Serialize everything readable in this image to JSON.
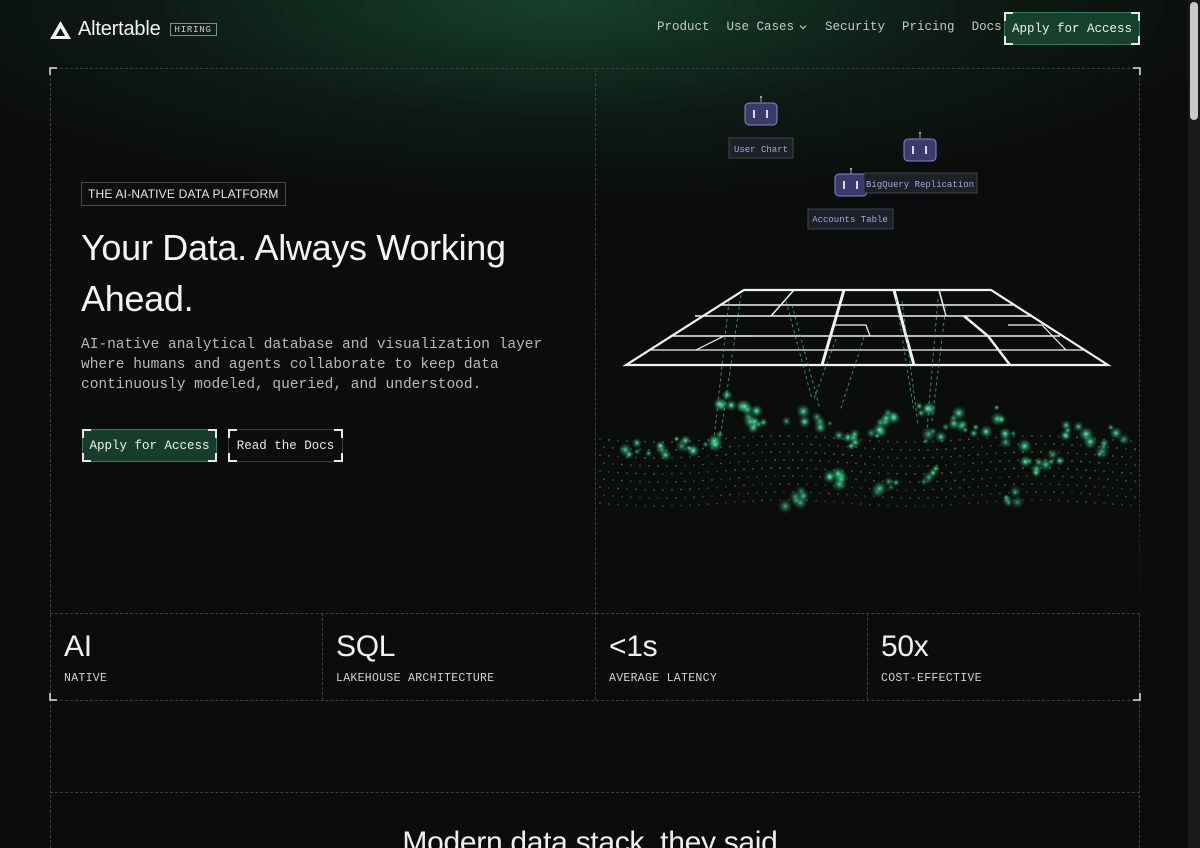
{
  "header": {
    "brand": "Altertable",
    "badge": "HIRING",
    "nav": [
      {
        "label": "Product"
      },
      {
        "label": "Use Cases",
        "has_dropdown": true
      },
      {
        "label": "Security"
      },
      {
        "label": "Pricing"
      },
      {
        "label": "Docs"
      }
    ],
    "cta_label": "Apply for Access"
  },
  "hero": {
    "eyebrow": "THE AI-NATIVE DATA PLATFORM",
    "headline": "Your Data. Always Working Ahead.",
    "subcopy": "AI-native analytical database and visualization layer where humans and agents collaborate to keep data continuously modeled, queried, and understood.",
    "primary_cta": "Apply for Access",
    "secondary_cta": "Read the Docs"
  },
  "visualization": {
    "agents": [
      {
        "label": "User Chart"
      },
      {
        "label": "BigQuery Replication"
      },
      {
        "label": "Accounts Table"
      }
    ]
  },
  "stats": [
    {
      "value": "AI",
      "label": "NATIVE"
    },
    {
      "value": "SQL",
      "label": "LAKEHOUSE ARCHITECTURE"
    },
    {
      "value": "<1s",
      "label": "AVERAGE LATENCY"
    },
    {
      "value": "50x",
      "label": "COST-EFFECTIVE"
    }
  ],
  "next_section": {
    "title": "Modern data stack, they said."
  },
  "colors": {
    "accent": "#2f7e57",
    "agent_tag": "#a8a3e0",
    "dot_glow": "#4fe0a0"
  }
}
